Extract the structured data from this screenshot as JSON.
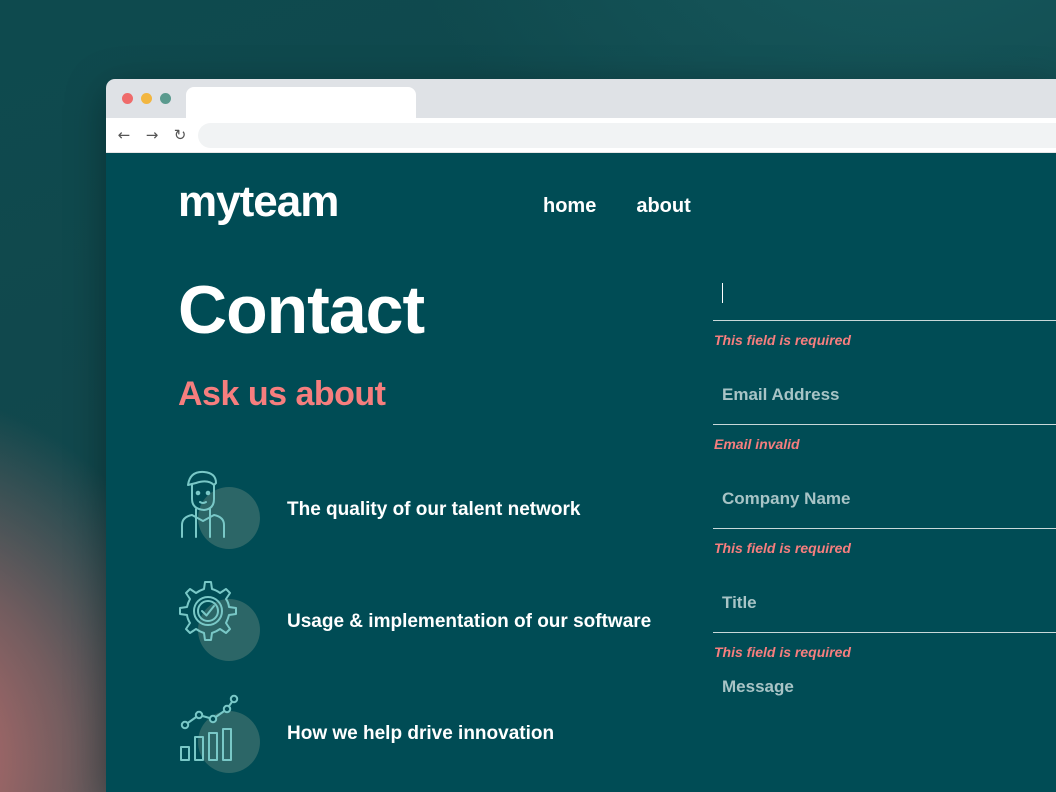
{
  "browser": {
    "nav_back": "←",
    "nav_forward": "→",
    "nav_reload": "↻"
  },
  "site": {
    "logo": "myteam",
    "nav": [
      {
        "label": "home"
      },
      {
        "label": "about"
      }
    ]
  },
  "contact": {
    "heading": "Contact",
    "subheading": "Ask us about",
    "features": [
      {
        "label": "The quality of our talent network",
        "icon": "person-icon"
      },
      {
        "label": "Usage & implementation of our software",
        "icon": "gear-check-icon"
      },
      {
        "label": "How we help drive innovation",
        "icon": "chart-icon"
      }
    ]
  },
  "form": {
    "name": {
      "value": "",
      "placeholder": "",
      "error": "This field is required"
    },
    "email": {
      "value": "",
      "placeholder": "Email Address",
      "error": "Email invalid"
    },
    "company": {
      "value": "",
      "placeholder": "Company Name",
      "error": "This field is required"
    },
    "title": {
      "value": "",
      "placeholder": "Title",
      "error": "This field is required"
    },
    "message": {
      "value": "",
      "placeholder": "Message"
    }
  },
  "colors": {
    "page_bg": "#004c55",
    "accent_coral": "#f67e7e",
    "icon_teal": "#79c8c7",
    "white": "#ffffff"
  }
}
